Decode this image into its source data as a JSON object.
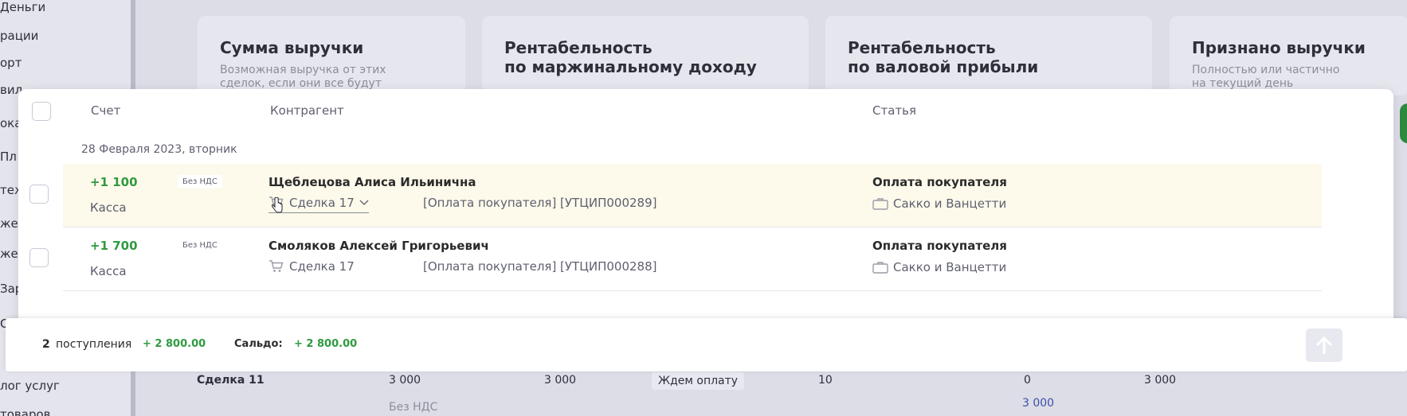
{
  "background": {
    "sidebar_items": [
      "Деньги",
      "рации",
      "орт",
      "вил",
      "ока",
      "Пл",
      "теж",
      "жет",
      "жет",
      "Зар",
      "С",
      "лог услуг",
      "товаров"
    ],
    "cards": [
      {
        "title": "Сумма выручки",
        "subtitle": "Возможная выручка от этих\nсделок, если они все будут"
      },
      {
        "title": "Рентабельность\nпо маржинальному доходу",
        "subtitle": ""
      },
      {
        "title": "Рентабельность\nпо валовой прибыли",
        "subtitle": ""
      },
      {
        "title": "Признано выручки",
        "subtitle": "Полностью или частично\nна текущий день"
      }
    ],
    "table_row": {
      "deal": "Сделка 11",
      "amount1": "3 000",
      "vat": "Без НДС",
      "amount2": "3 000",
      "status": "Ждем оплату",
      "qty": "10",
      "zero": "0",
      "amount3": "3 000",
      "amount_blue": "3 000"
    }
  },
  "modal": {
    "columns": {
      "account": "Счет",
      "contractor": "Контрагент",
      "article": "Статья"
    },
    "date_group": "28 Февраля 2023, вторник",
    "rows": [
      {
        "amount": "+1 100",
        "vat": "Без НДС",
        "account": "Касса",
        "contractor": "Щеблецова Алиса Ильинична",
        "deal": "Сделка 17",
        "description": "[Оплата покупателя] [УТЦИП000289]",
        "article": "Оплата покупателя",
        "project": "Сакко и Ванцетти"
      },
      {
        "amount": "+1 700",
        "vat": "Без НДС",
        "account": "Касса",
        "contractor": "Смоляков Алексей Григорьевич",
        "deal": "Сделка 17",
        "description": "[Оплата покупателя] [УТЦИП000288]",
        "article": "Оплата покупателя",
        "project": "Сакко и Ванцетти"
      }
    ]
  },
  "footer": {
    "count": "2",
    "count_label": "поступления",
    "sum": "+ 2 800.00",
    "saldo_label": "Сальдо:",
    "saldo": "+ 2 800.00"
  },
  "colors": {
    "accent_green": "#2f9a3f",
    "highlight_row": "#fdf9eb"
  },
  "icons": [
    "cart-icon",
    "chevron-down-icon",
    "briefcase-icon",
    "arrow-up-icon",
    "cursor-icon"
  ]
}
